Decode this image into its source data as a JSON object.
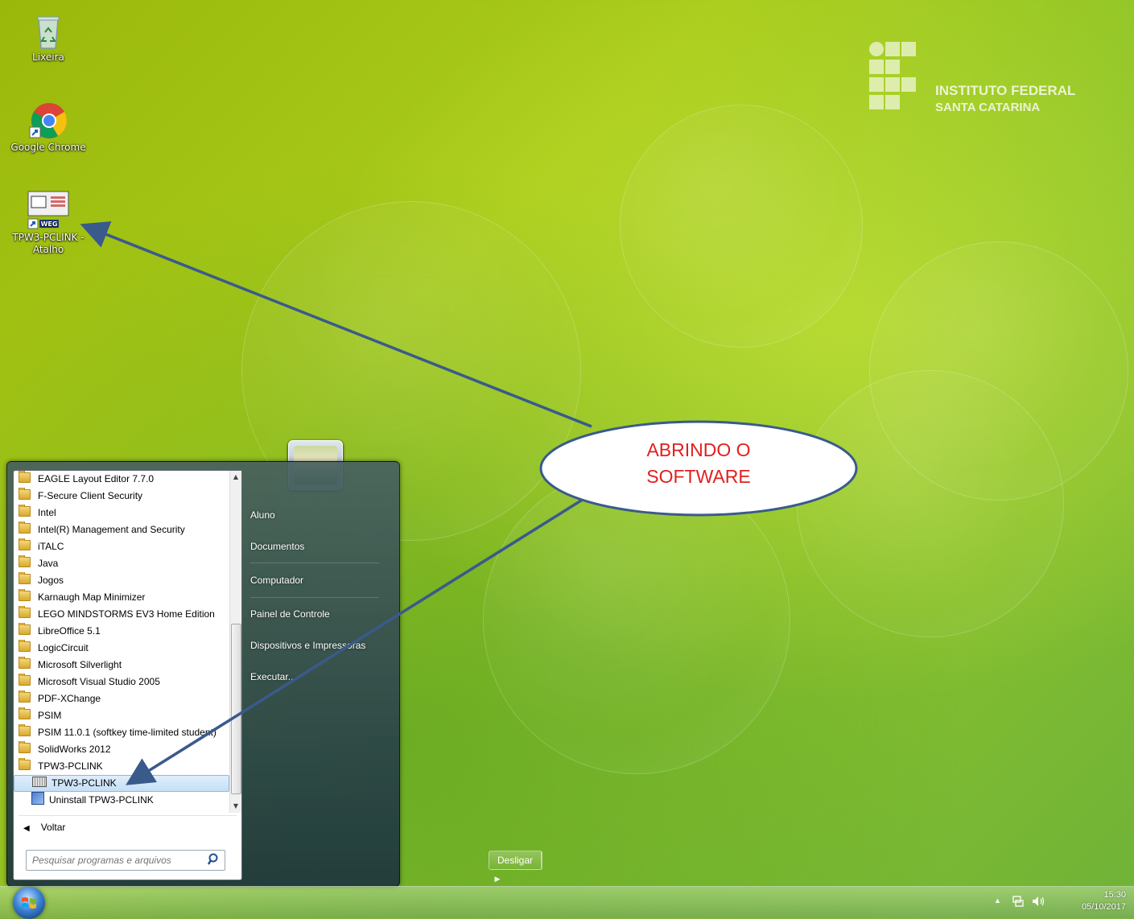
{
  "desktop": {
    "icons": [
      {
        "label": "Lixeira"
      },
      {
        "label": "Google Chrome"
      },
      {
        "label": "TPW3-PCLINK - Atalho"
      }
    ],
    "logo": {
      "line1": "INSTITUTO FEDERAL",
      "line2": "SANTA CATARINA"
    }
  },
  "start_menu": {
    "programs": [
      "EAGLE Layout Editor 7.7.0",
      "F-Secure Client Security",
      "Intel",
      "Intel(R) Management and Security",
      "iTALC",
      "Java",
      "Jogos",
      "Karnaugh Map Minimizer",
      "LEGO MINDSTORMS EV3 Home Edition",
      "LibreOffice 5.1",
      "LogicCircuit",
      "Microsoft Silverlight",
      "Microsoft Visual Studio 2005",
      "PDF-XChange",
      "PSIM",
      "PSIM 11.0.1 (softkey time-limited student)",
      "SolidWorks 2012",
      "TPW3-PCLINK"
    ],
    "subitems": [
      {
        "label": "TPW3-PCLINK",
        "selected": true
      },
      {
        "label": "Uninstall TPW3-PCLINK",
        "selected": false
      }
    ],
    "back_label": "Voltar",
    "search_placeholder": "Pesquisar programas e arquivos",
    "right_items": [
      "Aluno",
      "Documentos",
      "Computador",
      "Painel de Controle",
      "Dispositivos e Impressoras",
      "Executar..."
    ],
    "shutdown_label": "Desligar"
  },
  "taskbar": {
    "time": "15:30",
    "date": "05/10/2017"
  },
  "callout": {
    "line1": "ABRINDO O",
    "line2": "SOFTWARE",
    "text_color": "#e02020",
    "arrow_color": "#3a5a8c"
  }
}
